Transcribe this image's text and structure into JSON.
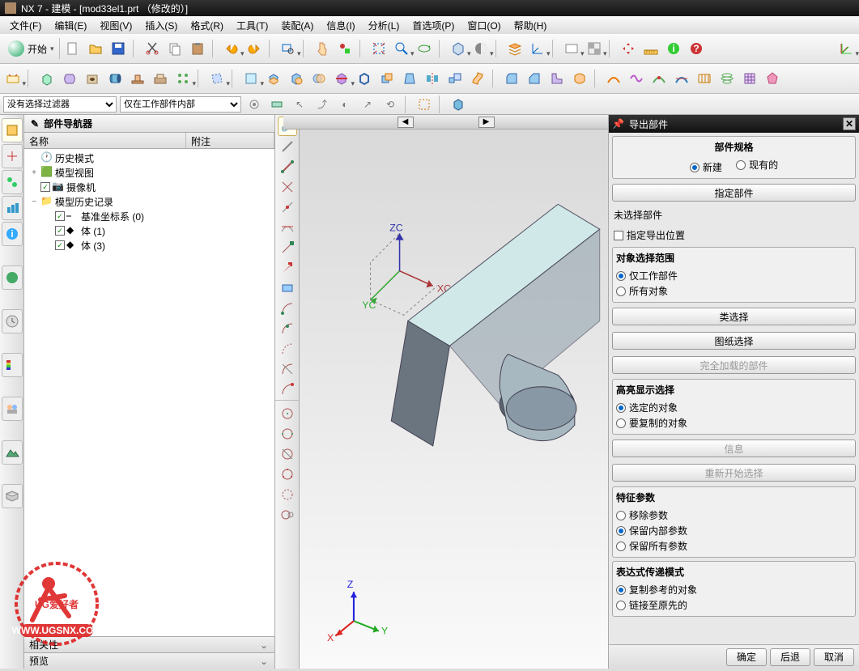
{
  "title": "NX 7 - 建模 - [mod33el1.prt （修改的）]",
  "menu": [
    "文件(F)",
    "编辑(E)",
    "视图(V)",
    "插入(S)",
    "格式(R)",
    "工具(T)",
    "装配(A)",
    "信息(I)",
    "分析(L)",
    "首选项(P)",
    "窗口(O)",
    "帮助(H)"
  ],
  "start_label": "开始",
  "filters": {
    "f1": "没有选择过滤器",
    "f2": "仅在工作部件内部"
  },
  "navigator": {
    "title": "部件导航器",
    "cols": [
      "名称",
      "附注"
    ],
    "items": [
      {
        "indent": 0,
        "exp": "",
        "icon": "clock",
        "label": "历史模式"
      },
      {
        "indent": 0,
        "exp": "+",
        "icon": "cube-g",
        "label": "模型视图"
      },
      {
        "indent": 0,
        "exp": "",
        "chk": true,
        "icon": "camera",
        "label": "摄像机"
      },
      {
        "indent": 0,
        "exp": "−",
        "icon": "folder",
        "label": "模型历史记录"
      },
      {
        "indent": 1,
        "exp": "",
        "chk": true,
        "icon": "csys",
        "label": "基准坐标系 (0)"
      },
      {
        "indent": 1,
        "exp": "",
        "chk": true,
        "icon": "body",
        "label": "体 (1)"
      },
      {
        "indent": 1,
        "exp": "",
        "chk": true,
        "icon": "body",
        "label": "体 (3)"
      }
    ],
    "rel": "相关性",
    "prev": "预览"
  },
  "splitter": {
    "left": "◀",
    "right": "▶"
  },
  "panel": {
    "title": "导出部件",
    "spec_title": "部件规格",
    "spec_new": "新建",
    "spec_exist": "现有的",
    "specify_part": "指定部件",
    "no_sel": "未选择部件",
    "specify_pos": "指定导出位置",
    "scope_title": "对象选择范围",
    "scope_work": "仅工作部件",
    "scope_all": "所有对象",
    "class_sel": "类选择",
    "drawing_sel": "图纸选择",
    "full_load": "完全加载的部件",
    "hl_title": "高亮显示选择",
    "hl_sel": "选定的对象",
    "hl_copy": "要复制的对象",
    "info": "信息",
    "restart": "重新开始选择",
    "feat_title": "特征参数",
    "feat_remove": "移除参数",
    "feat_keep": "保留内部参数",
    "feat_all": "保留所有参数",
    "expr_title": "表达式传递模式",
    "expr_copy": "复制参考的对象",
    "expr_link": "链接至原先的",
    "ok": "确定",
    "back": "后退",
    "cancel": "取消"
  },
  "watermark": {
    "line1": "UG爱好者",
    "url": "WWW.UGSNX.COM"
  }
}
